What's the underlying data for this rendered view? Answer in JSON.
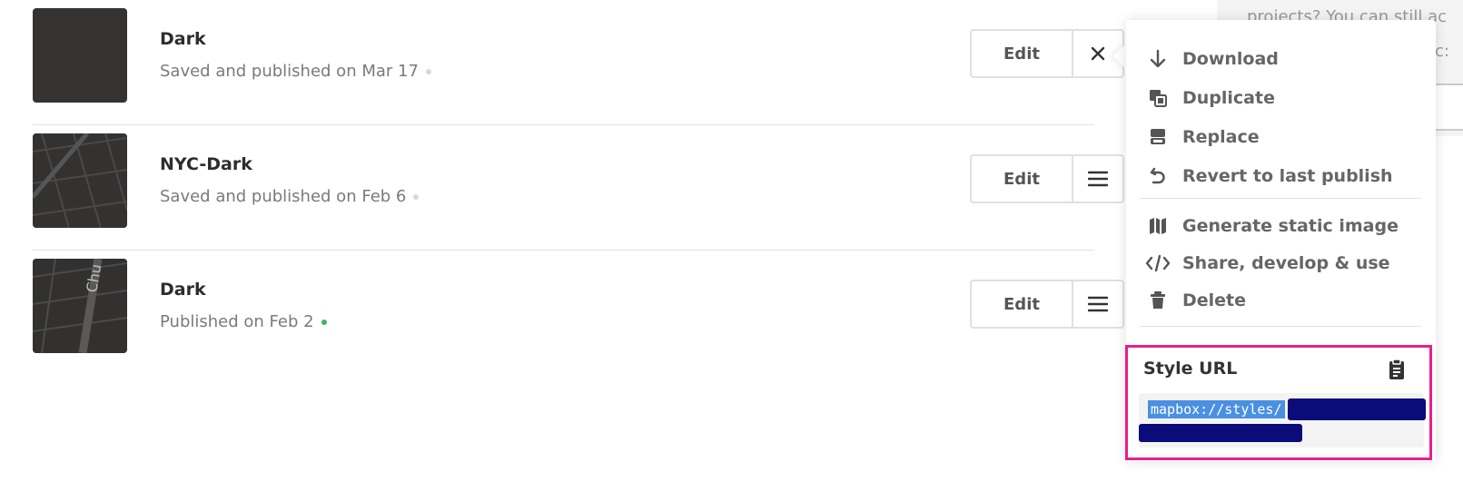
{
  "styles": [
    {
      "name": "Dark",
      "status": "Saved and published on Mar 17",
      "edit_label": "Edit",
      "action_icon": "close-icon"
    },
    {
      "name": "NYC-Dark",
      "status": "Saved and published on Feb 6",
      "edit_label": "Edit",
      "action_icon": "menu-icon"
    },
    {
      "name": "Dark",
      "status": "Published on Feb 2",
      "edit_label": "Edit",
      "action_icon": "menu-icon",
      "thumb_text": "Chu"
    }
  ],
  "menu": {
    "items": [
      {
        "label": "Download",
        "icon": "download-icon"
      },
      {
        "label": "Duplicate",
        "icon": "duplicate-icon"
      },
      {
        "label": "Replace",
        "icon": "replace-icon"
      },
      {
        "label": "Revert to last publish",
        "icon": "revert-icon"
      },
      {
        "label": "Generate static image",
        "icon": "map-icon"
      },
      {
        "label": "Share, develop & use",
        "icon": "code-icon"
      },
      {
        "label": "Delete",
        "icon": "trash-icon"
      }
    ],
    "style_url": {
      "title": "Style URL",
      "value": "mapbox://styles/"
    }
  },
  "background": {
    "line1": "projects? You can still ac",
    "line2": "c:"
  },
  "colors": {
    "accent": "#ea1e8a",
    "published_dot": "#3db36b",
    "selection": "#4a90e2"
  }
}
